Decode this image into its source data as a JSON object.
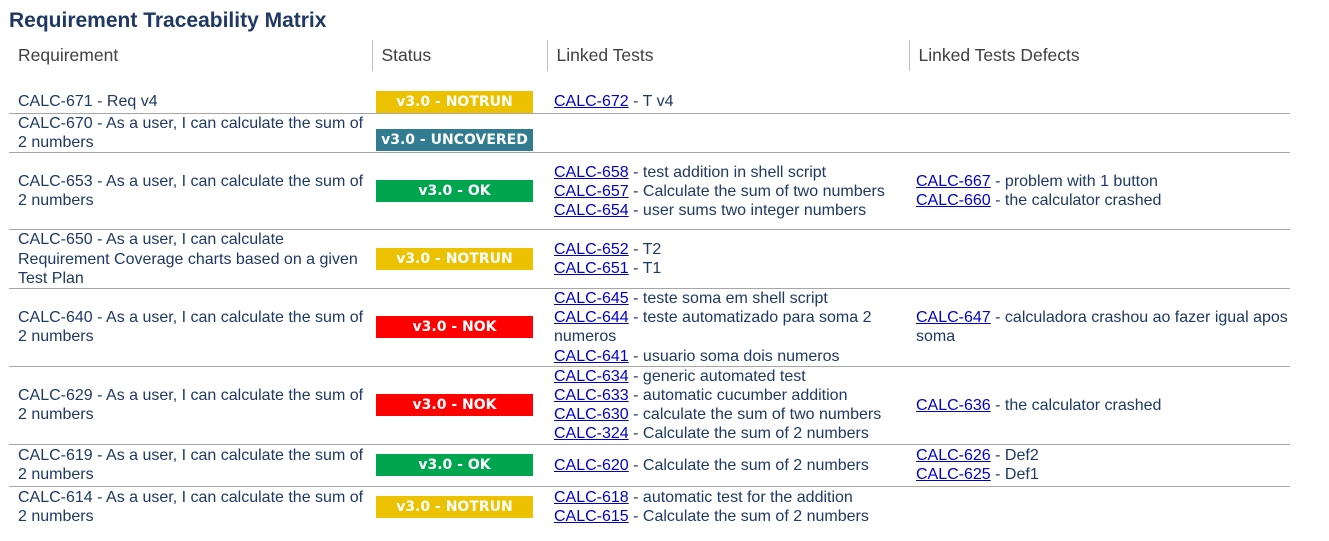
{
  "page": {
    "title": "Requirement Traceability Matrix"
  },
  "columns": {
    "requirement": "Requirement",
    "status": "Status",
    "linked_tests": "Linked Tests",
    "linked_defects": "Linked Tests Defects"
  },
  "rows": [
    {
      "requirement": "CALC-671 - Req v4",
      "status": "v3.0 - NOTRUN",
      "tests": [
        {
          "key": "CALC-672",
          "summary": " - T v4"
        }
      ],
      "defects": []
    },
    {
      "requirement": "CALC-670 - As a user, I can calculate the sum of 2 numbers",
      "status": "v3.0 - UNCOVERED",
      "tests": [],
      "defects": []
    },
    {
      "requirement": "CALC-653 - As a user, I can calculate the sum of 2 numbers",
      "status": "v3.0 - OK",
      "tests": [
        {
          "key": "CALC-658",
          "summary": " - test addition in shell script"
        },
        {
          "key": "CALC-657",
          "summary": " - Calculate the sum of two numbers"
        },
        {
          "key": "CALC-654",
          "summary": " - user sums two integer numbers"
        }
      ],
      "defects": [
        {
          "key": "CALC-667",
          "summary": " - problem with 1 button"
        },
        {
          "key": "CALC-660",
          "summary": " - the calculator crashed"
        }
      ]
    },
    {
      "requirement": "CALC-650 - As a user, I can calculate Requirement Coverage charts based on a given Test Plan",
      "status": "v3.0 - NOTRUN",
      "tests": [
        {
          "key": "CALC-652",
          "summary": " - T2"
        },
        {
          "key": "CALC-651",
          "summary": " - T1"
        }
      ],
      "defects": []
    },
    {
      "requirement": "CALC-640 - As a user, I can calculate the sum of 2 numbers",
      "status": "v3.0 - NOK",
      "tests": [
        {
          "key": "CALC-645",
          "summary": " - teste soma em shell script"
        },
        {
          "key": "CALC-644",
          "summary": " - teste automatizado para soma 2 numeros"
        },
        {
          "key": "CALC-641",
          "summary": " - usuario soma dois numeros"
        }
      ],
      "defects": [
        {
          "key": "CALC-647",
          "summary": " - calculadora crashou ao fazer igual apos soma"
        }
      ]
    },
    {
      "requirement": "CALC-629 - As a user, I can calculate the sum of 2 numbers",
      "status": "v3.0 - NOK",
      "tests": [
        {
          "key": "CALC-634",
          "summary": " - generic automated test"
        },
        {
          "key": "CALC-633",
          "summary": " - automatic cucumber addition"
        },
        {
          "key": "CALC-630",
          "summary": " - calculate the sum of two numbers"
        },
        {
          "key": "CALC-324",
          "summary": " - Calculate the sum of 2 numbers"
        }
      ],
      "defects": [
        {
          "key": "CALC-636",
          "summary": " - the calculator crashed"
        }
      ]
    },
    {
      "requirement": "CALC-619 - As a user, I can calculate the sum of 2 numbers",
      "status": "v3.0 - OK",
      "tests": [
        {
          "key": "CALC-620",
          "summary": " - Calculate the sum of 2 numbers"
        }
      ],
      "defects": [
        {
          "key": "CALC-626",
          "summary": " - Def2"
        },
        {
          "key": "CALC-625",
          "summary": " - Def1"
        }
      ]
    },
    {
      "requirement": "CALC-614 - As a user, I can calculate the sum of 2 numbers",
      "status": "v3.0 - NOTRUN",
      "tests": [
        {
          "key": "CALC-618",
          "summary": " - automatic test for the addition"
        },
        {
          "key": "CALC-615",
          "summary": " - Calculate the sum of 2 numbers"
        }
      ],
      "defects": []
    }
  ],
  "status_colors": {
    "v3.0 - NOTRUN": "#ecc100",
    "v3.0 - UNCOVERED": "#327c92",
    "v3.0 - OK": "#00a54f",
    "v3.0 - NOK": "#fe0000"
  }
}
